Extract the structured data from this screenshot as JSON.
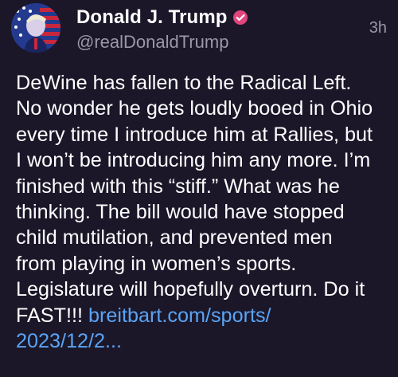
{
  "post": {
    "author_name": "Donald J. Trump",
    "handle": "@realDonaldTrump",
    "timestamp": "3h",
    "text": "DeWine has fallen to the Radical Left.\nNo wonder he gets loudly booed in Ohio\nevery time I introduce him at Rallies, but\nI won’t be introducing him any more. I’m\nfinished with this “stiff.” What was he\nthinking. The bill would have stopped\nchild mutilation, and prevented men\nfrom playing in women’s sports.\nLegislature will hopefully overturn. Do it\nFAST!!! ",
    "link_text": "breitbart.com/sports/\n2023/12/2...",
    "avatar_icon": "avatar-flag-portrait",
    "verified_icon": "verified-badge-icon",
    "colors": {
      "background": "#1b1729",
      "link": "#5aa3f5",
      "muted": "#9a97a8",
      "verified": "#e0457b"
    }
  }
}
